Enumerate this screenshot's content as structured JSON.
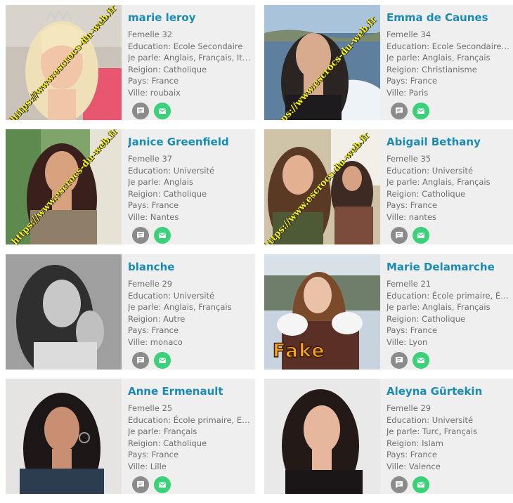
{
  "watermark": "https://www.escrocs-du-web.fr",
  "fake_label": "Fake",
  "profiles": [
    {
      "name": "marie leroy",
      "age_line": "Femelle 32",
      "education": "Education: Ecole Secondaire",
      "languages": "Je parle: Anglais, Français, Ital...",
      "religion": "Reigion: Catholique",
      "country": "Pays: France",
      "city": "Ville: roubaix"
    },
    {
      "name": "Emma de Caunes",
      "age_line": "Femelle 34",
      "education": "Education: Ecole Secondaire, ...",
      "languages": "Je parle: Anglais, Français",
      "religion": "Reigion: Christianisme",
      "country": "Pays: France",
      "city": "Ville: Paris"
    },
    {
      "name": "Janice Greenfield",
      "age_line": "Femelle 37",
      "education": "Education: Université",
      "languages": "Je parle: Anglais",
      "religion": "Reigion: Catholique",
      "country": "Pays: France",
      "city": "Ville: Nantes"
    },
    {
      "name": "Abigail Bethany",
      "age_line": "Femelle 35",
      "education": "Education: Université",
      "languages": "Je parle: Anglais, Français",
      "religion": "Reigion: Catholique",
      "country": "Pays: France",
      "city": "Ville: nantes"
    },
    {
      "name": "blanche",
      "age_line": "Femelle 29",
      "education": "Education: Université",
      "languages": "Je parle: Anglais, Français",
      "religion": "Reigion: Autre",
      "country": "Pays: France",
      "city": "Ville: monaco"
    },
    {
      "name": "Marie Delamarche",
      "age_line": "Femelle 21",
      "education": "Education: École primaire, Éco...",
      "languages": "Je parle: Anglais, Français",
      "religion": "Reigion: Catholique",
      "country": "Pays: France",
      "city": "Ville: Lyon"
    },
    {
      "name": "Anne Ermenault",
      "age_line": "Femelle 25",
      "education": "Education: École primaire, Eco...",
      "languages": "Je parle: Français",
      "religion": "Reigion: Catholique",
      "country": "Pays: France",
      "city": "Ville: Lille"
    },
    {
      "name": "Aleyna Gürtekin",
      "age_line": "Femelle 29",
      "education": "Education: Université",
      "languages": "Je parle: Turc, Français",
      "religion": "Reigion: Islam",
      "country": "Pays: France",
      "city": "Ville: Valence"
    }
  ],
  "colors": {
    "name": "#1b8bb3",
    "text": "#6f6f6f",
    "card_bg": "#efefef",
    "message_button": "#8b8b8b",
    "mail_button": "#3bd07a",
    "watermark": "#f4ee1d"
  },
  "icons": {
    "message": "chat-bubble-icon",
    "mail": "envelope-icon"
  }
}
